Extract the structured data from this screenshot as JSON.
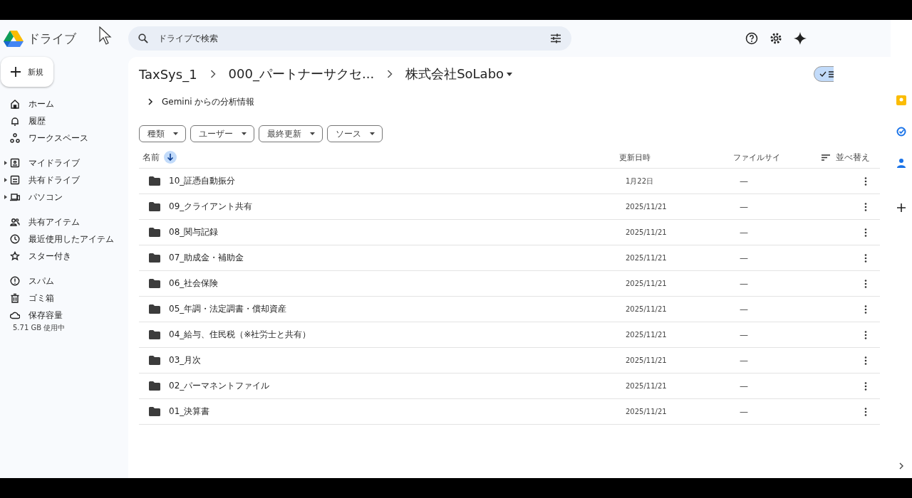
{
  "app": {
    "name": "ドライブ"
  },
  "search": {
    "placeholder": "ドライブで検索"
  },
  "new_button": {
    "label": "新規"
  },
  "sidebar": {
    "groups": [
      [
        {
          "label": "ホーム",
          "expandable": false
        },
        {
          "label": "履歴",
          "expandable": false
        },
        {
          "label": "ワークスペース",
          "expandable": false
        }
      ],
      [
        {
          "label": "マイドライブ",
          "expandable": true
        },
        {
          "label": "共有ドライブ",
          "expandable": true
        },
        {
          "label": "パソコン",
          "expandable": true
        }
      ],
      [
        {
          "label": "共有アイテム",
          "expandable": false
        },
        {
          "label": "最近使用したアイテム",
          "expandable": false
        },
        {
          "label": "スター付き",
          "expandable": false
        }
      ],
      [
        {
          "label": "スパム",
          "expandable": false
        },
        {
          "label": "ゴミ箱",
          "expandable": false
        },
        {
          "label": "保存容量",
          "expandable": false
        }
      ]
    ],
    "storage": "5.71 GB 使用中"
  },
  "view_toggle": {
    "list_selected": true
  },
  "breadcrumb": [
    "TaxSys_1",
    "000_パートナーサクセ...",
    "株式会社SoLabo"
  ],
  "gemini": {
    "label": "Gemini からの分析情報"
  },
  "filters": [
    "種類",
    "ユーザー",
    "最終更新",
    "ソース"
  ],
  "table": {
    "columns": [
      "名前",
      "更新日時",
      "ファイルサイ",
      "並べ替え"
    ],
    "rows": [
      {
        "name": "10_証憑自動振分",
        "modified": "1月22日",
        "size": "—"
      },
      {
        "name": "09_クライアント共有",
        "modified": "2025/11/21",
        "size": "—"
      },
      {
        "name": "08_関与記録",
        "modified": "2025/11/21",
        "size": "—"
      },
      {
        "name": "07_助成金・補助金",
        "modified": "2025/11/21",
        "size": "—"
      },
      {
        "name": "06_社会保険",
        "modified": "2025/11/21",
        "size": "—"
      },
      {
        "name": "05_年調・法定調書・償却資産",
        "modified": "2025/11/21",
        "size": "—"
      },
      {
        "name": "04_給与、住民税（※社労士と共有）",
        "modified": "2025/11/21",
        "size": "—"
      },
      {
        "name": "03_月次",
        "modified": "2025/11/21",
        "size": "—"
      },
      {
        "name": "02_パーマネントファイル",
        "modified": "2025/11/21",
        "size": "—"
      },
      {
        "name": "01_決算書",
        "modified": "2025/11/21",
        "size": "—"
      }
    ]
  }
}
